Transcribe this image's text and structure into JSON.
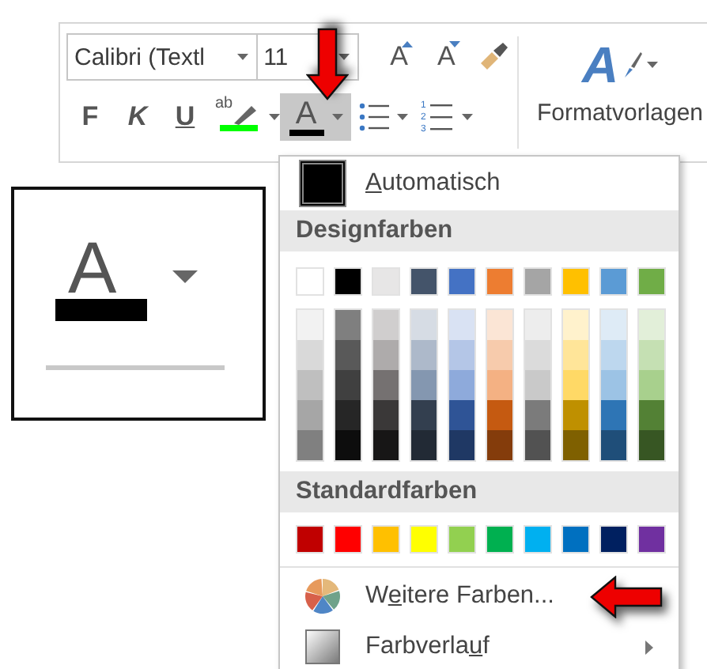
{
  "ribbon": {
    "font_name": {
      "value": "Calibri (Textl"
    },
    "font_size": {
      "value": "11"
    },
    "grow_font": {
      "label": "A"
    },
    "shrink_font": {
      "label": "A"
    },
    "bold": {
      "label": "F"
    },
    "italic": {
      "label": "K"
    },
    "underline": {
      "label": "U"
    },
    "highlight": {
      "label": "ab",
      "color": "#00ff00"
    },
    "font_color": {
      "label": "A",
      "color": "#000000",
      "selected": true
    },
    "numbering": {
      "numbers": [
        "1",
        "2",
        "3"
      ]
    },
    "styles": {
      "icon_letter": "A",
      "label": "Formatvorlagen"
    }
  },
  "zoom_inset": {
    "letter": "A",
    "color": "#000000"
  },
  "menu": {
    "automatic": {
      "key": "A",
      "rest": "utomatisch",
      "color": "#000000"
    },
    "theme_header": "Designfarben",
    "theme_colors": [
      {
        "color": "#ffffff",
        "shades": [
          {
            "color": "#f2f2f2"
          },
          {
            "color": "#d9d9d9"
          },
          {
            "color": "#bfbfbf"
          },
          {
            "color": "#a6a6a6"
          },
          {
            "color": "#808080"
          }
        ]
      },
      {
        "color": "#000000",
        "shades": [
          {
            "color": "#7f7f7f"
          },
          {
            "color": "#595959"
          },
          {
            "color": "#404040"
          },
          {
            "color": "#262626"
          },
          {
            "color": "#0d0d0d"
          }
        ]
      },
      {
        "color": "#e7e6e6",
        "shades": [
          {
            "color": "#d0cece"
          },
          {
            "color": "#aeabab"
          },
          {
            "color": "#757171"
          },
          {
            "color": "#3a3838"
          },
          {
            "color": "#171616"
          }
        ]
      },
      {
        "color": "#44546a",
        "shades": [
          {
            "color": "#d6dce4"
          },
          {
            "color": "#adb9ca"
          },
          {
            "color": "#8497b0"
          },
          {
            "color": "#333f4f"
          },
          {
            "color": "#222a35"
          }
        ]
      },
      {
        "color": "#4472c4",
        "shades": [
          {
            "color": "#d9e2f3"
          },
          {
            "color": "#b4c6e7"
          },
          {
            "color": "#8eaadb"
          },
          {
            "color": "#2f5496"
          },
          {
            "color": "#1f3864"
          }
        ]
      },
      {
        "color": "#ed7d31",
        "shades": [
          {
            "color": "#fbe5d5"
          },
          {
            "color": "#f7cbac"
          },
          {
            "color": "#f4b183"
          },
          {
            "color": "#c55a11"
          },
          {
            "color": "#843c0b"
          }
        ]
      },
      {
        "color": "#a5a5a5",
        "shades": [
          {
            "color": "#ededed"
          },
          {
            "color": "#dbdbdb"
          },
          {
            "color": "#c9c9c9"
          },
          {
            "color": "#7b7b7b"
          },
          {
            "color": "#525252"
          }
        ]
      },
      {
        "color": "#ffc000",
        "shades": [
          {
            "color": "#fff2cc"
          },
          {
            "color": "#ffe599"
          },
          {
            "color": "#ffd966"
          },
          {
            "color": "#bf9000"
          },
          {
            "color": "#7f6000"
          }
        ]
      },
      {
        "color": "#5b9bd5",
        "shades": [
          {
            "color": "#deebf6"
          },
          {
            "color": "#bdd7ee"
          },
          {
            "color": "#9cc3e5"
          },
          {
            "color": "#2e75b5"
          },
          {
            "color": "#1f4e79"
          }
        ]
      },
      {
        "color": "#70ad47",
        "shades": [
          {
            "color": "#e2efd9"
          },
          {
            "color": "#c5e0b3"
          },
          {
            "color": "#a8d08d"
          },
          {
            "color": "#538135"
          },
          {
            "color": "#375623"
          }
        ]
      }
    ],
    "standard_header": "Standardfarben",
    "standard_colors": [
      {
        "color": "#c00000"
      },
      {
        "color": "#ff0000"
      },
      {
        "color": "#ffc000"
      },
      {
        "color": "#ffff00"
      },
      {
        "color": "#92d050"
      },
      {
        "color": "#00b050"
      },
      {
        "color": "#00b0f0"
      },
      {
        "color": "#0070c0"
      },
      {
        "color": "#002060"
      },
      {
        "color": "#7030a0"
      }
    ],
    "items": [
      {
        "kind": "more",
        "lead": "W",
        "key": "e",
        "rest": "itere Farben..."
      },
      {
        "kind": "gradient",
        "lead": "Farbverla",
        "key": "u",
        "rest": "f",
        "submenu": true
      }
    ]
  }
}
